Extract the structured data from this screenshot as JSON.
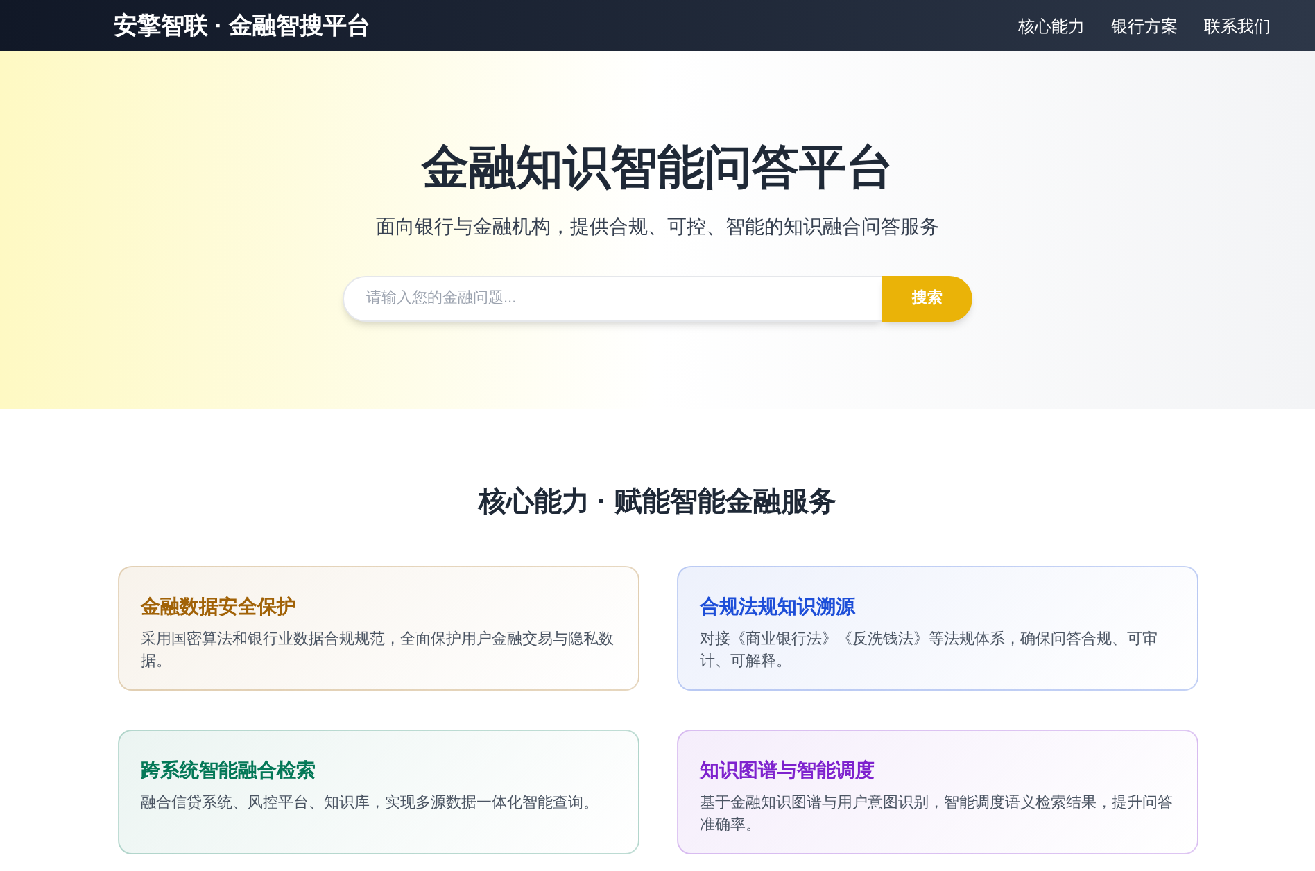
{
  "header": {
    "brand": "安擎智联 · 金融智搜平台",
    "nav": [
      {
        "label": "核心能力"
      },
      {
        "label": "银行方案"
      },
      {
        "label": "联系我们"
      }
    ]
  },
  "hero": {
    "title": "金融知识智能问答平台",
    "subtitle": "面向银行与金融机构，提供合规、可控、智能的知识融合问答服务",
    "search": {
      "placeholder": "请输入您的金融问题...",
      "button": "搜索"
    }
  },
  "features": {
    "title": "核心能力 · 赋能智能金融服务",
    "cards": [
      {
        "title": "金融数据安全保护",
        "description": "采用国密算法和银行业数据合规规范，全面保护用户金融交易与隐私数据。",
        "color": "#a16207"
      },
      {
        "title": "合规法规知识溯源",
        "description": "对接《商业银行法》《反洗钱法》等法规体系，确保问答合规、可审计、可解释。",
        "color": "#1d4ed8"
      },
      {
        "title": "跨系统智能融合检索",
        "description": "融合信贷系统、风控平台、知识库，实现多源数据一体化智能查询。",
        "color": "#047857"
      },
      {
        "title": "知识图谱与智能调度",
        "description": "基于金融知识图谱与用户意图识别，智能调度语义检索结果，提升问答准确率。",
        "color": "#7e22ce"
      }
    ]
  }
}
